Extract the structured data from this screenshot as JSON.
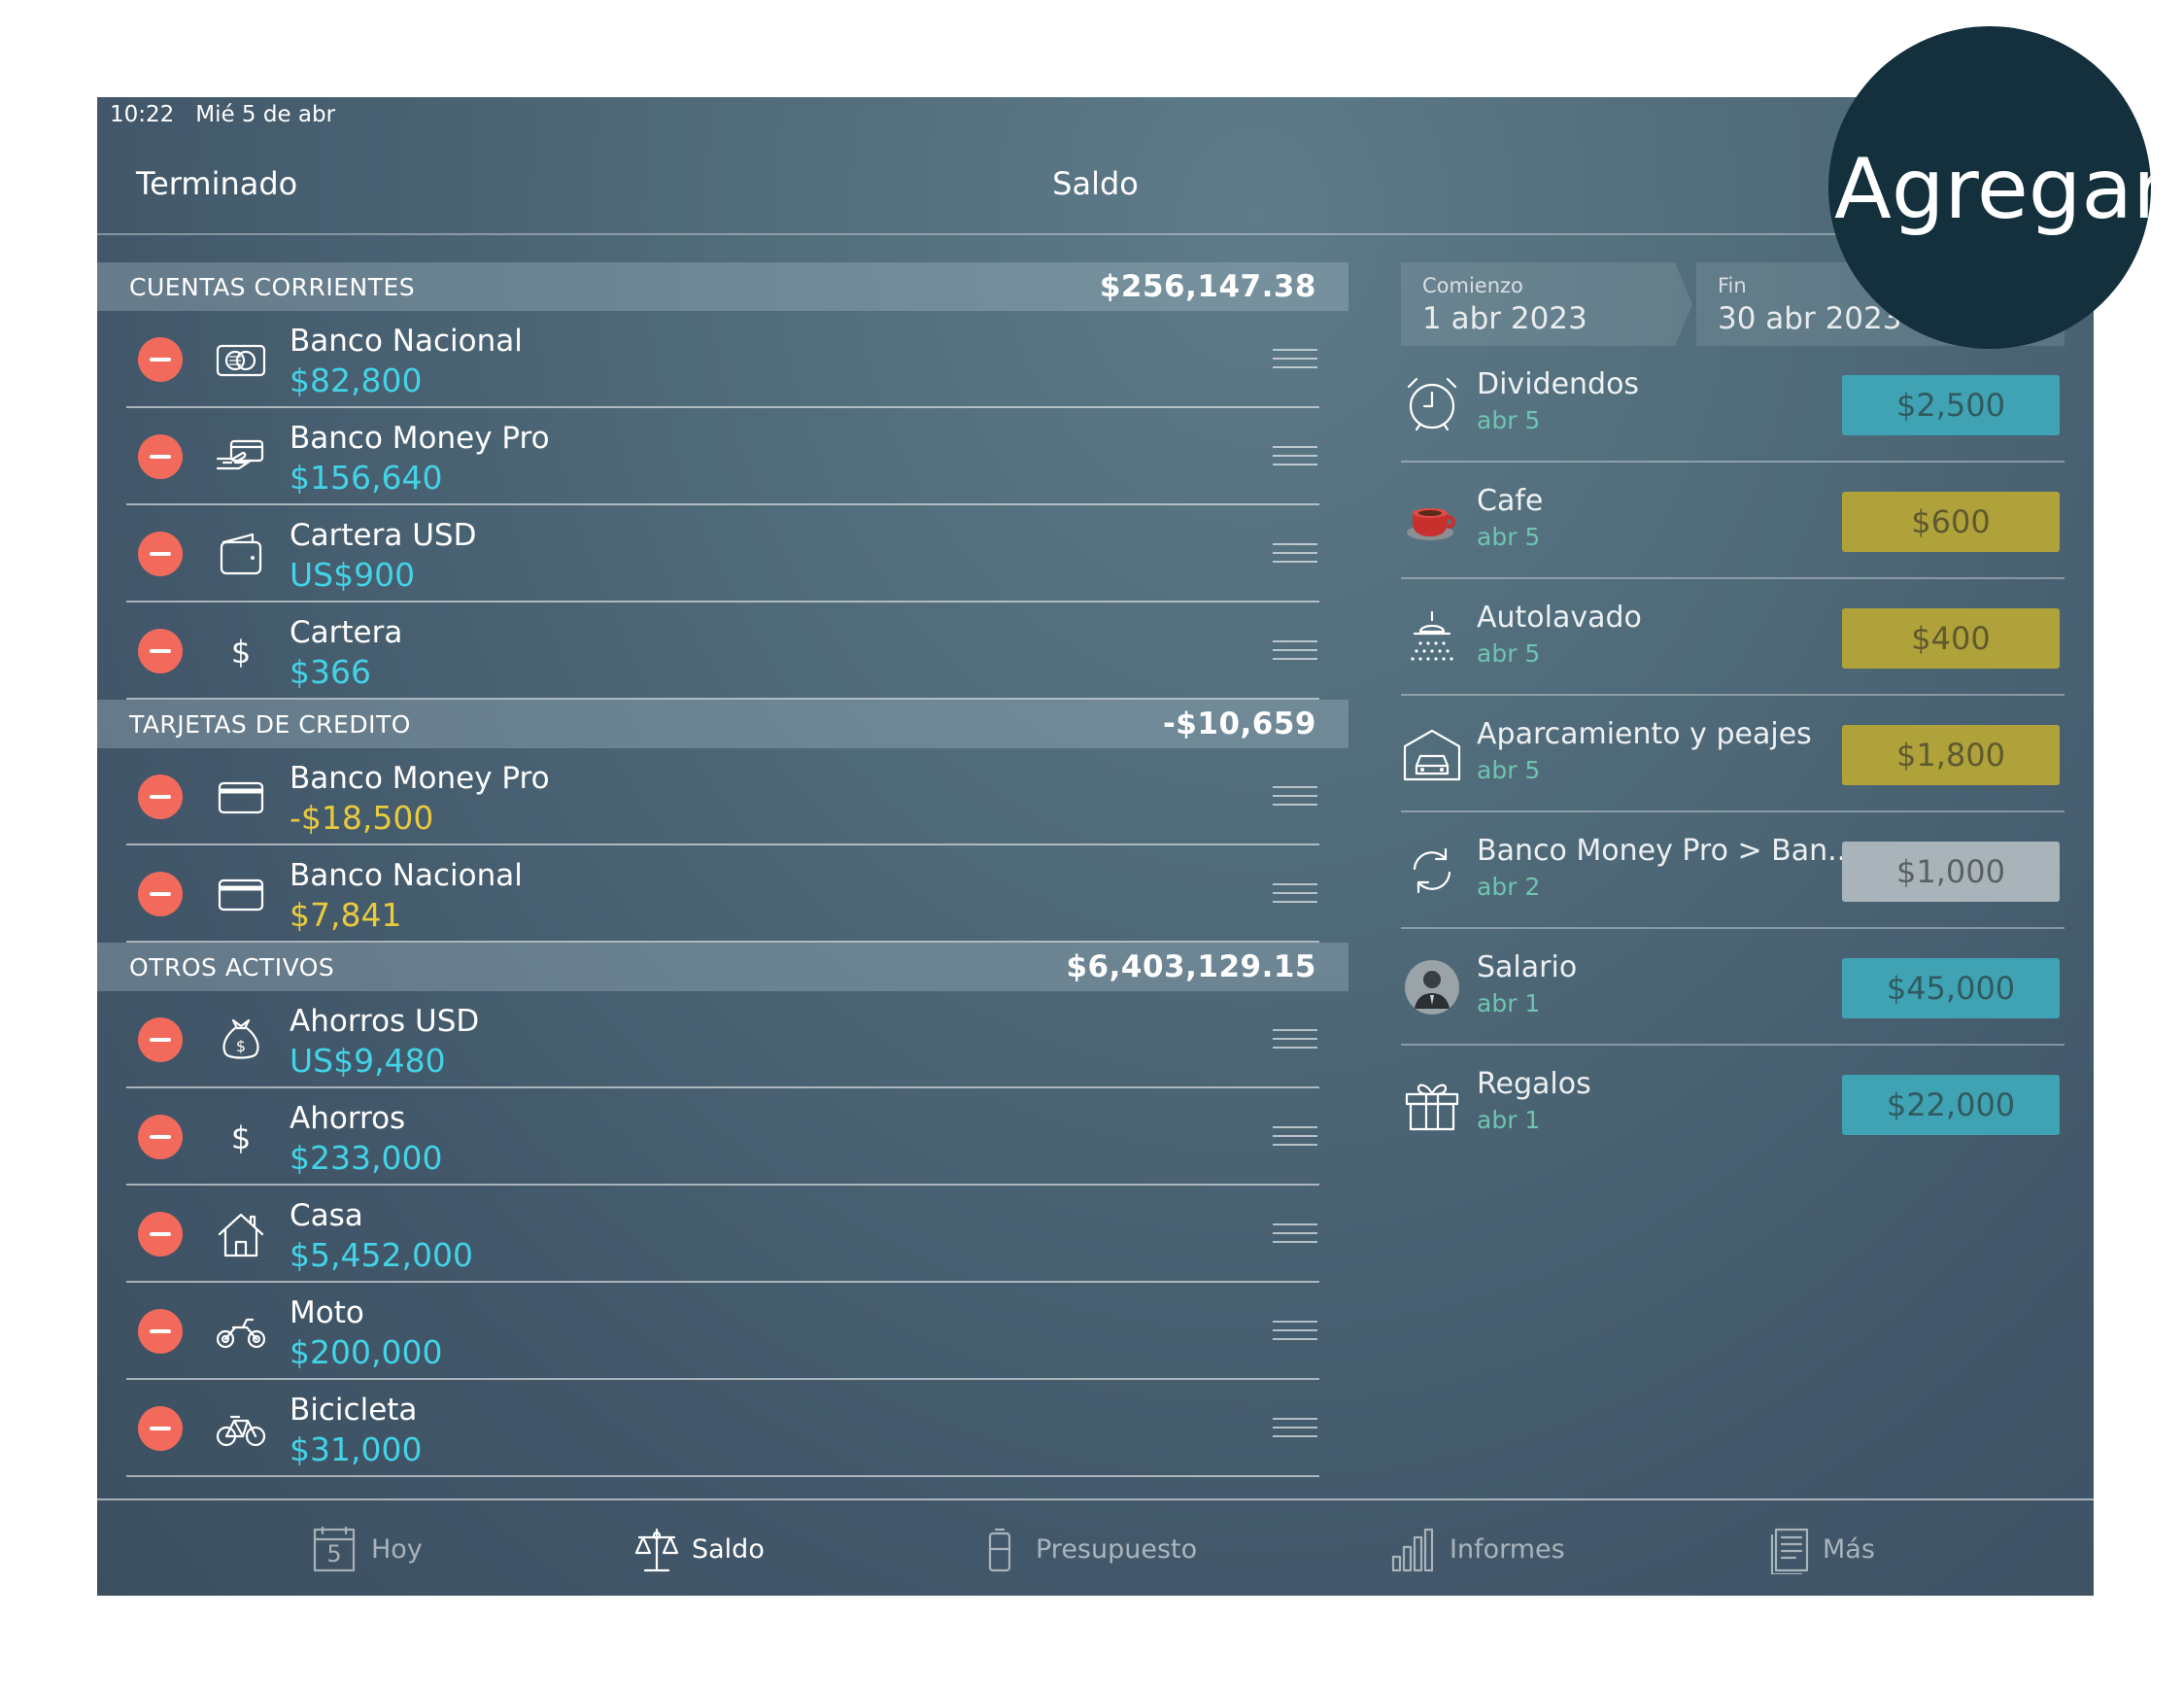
{
  "status_bar": {
    "time": "10:22",
    "date": "Mié 5 de abr"
  },
  "nav": {
    "done_label": "Terminado",
    "title": "Saldo",
    "add_label": "Agregar"
  },
  "sections": [
    {
      "name": "CUENTAS CORRIENTES",
      "total": "$256,147.38",
      "items": [
        {
          "name": "Banco Nacional",
          "amount": "$82,800",
          "icon": "bank-card-icon"
        },
        {
          "name": "Banco Money Pro",
          "amount": "$156,640",
          "icon": "hand-card-icon"
        },
        {
          "name": "Cartera USD",
          "amount": "US$900",
          "icon": "wallet-icon"
        },
        {
          "name": "Cartera",
          "amount": "$366",
          "icon": "dollar-icon"
        }
      ]
    },
    {
      "name": "TARJETAS DE CREDITO",
      "total": "-$10,659",
      "items": [
        {
          "name": "Banco Money Pro",
          "amount": "-$18,500",
          "icon": "credit-card-icon"
        },
        {
          "name": "Banco Nacional",
          "amount": "$7,841",
          "icon": "credit-card-icon"
        }
      ]
    },
    {
      "name": "OTROS ACTIVOS",
      "total": "$6,403,129.15",
      "items": [
        {
          "name": "Ahorros USD",
          "amount": "US$9,480",
          "icon": "money-bag-icon"
        },
        {
          "name": "Ahorros",
          "amount": "$233,000",
          "icon": "dollar-icon"
        },
        {
          "name": "Casa",
          "amount": "$5,452,000",
          "icon": "house-icon"
        },
        {
          "name": "Moto",
          "amount": "$200,000",
          "icon": "motorcycle-icon"
        },
        {
          "name": "Bicicleta",
          "amount": "$31,000",
          "icon": "bicycle-icon"
        }
      ]
    }
  ],
  "period": {
    "start_label": "Comienzo",
    "start_value": "1 abr 2023",
    "end_label": "Fin",
    "end_value": "30 abr 2023"
  },
  "transactions": [
    {
      "name": "Dividendos",
      "date": "abr 5",
      "amount": "$2,500",
      "color": "#3fa3b3",
      "icon": "alarm-clock-icon"
    },
    {
      "name": "Cafe",
      "date": "abr 5",
      "amount": "$600",
      "color": "#b0a23a",
      "icon": "coffee-cup-icon"
    },
    {
      "name": "Autolavado",
      "date": "abr 5",
      "amount": "$400",
      "color": "#b0a23a",
      "icon": "shower-icon"
    },
    {
      "name": "Aparcamiento y peajes",
      "date": "abr 5",
      "amount": "$1,800",
      "color": "#b0a23a",
      "icon": "garage-icon"
    },
    {
      "name": "Banco Money Pro > Ban...",
      "date": "abr 2",
      "amount": "$1,000",
      "color": "#a9b4ba",
      "icon": "transfer-icon"
    },
    {
      "name": "Salario",
      "date": "abr 1",
      "amount": "$45,000",
      "color": "#3fa3b3",
      "icon": "person-avatar-icon"
    },
    {
      "name": "Regalos",
      "date": "abr 1",
      "amount": "$22,000",
      "color": "#3fa3b3",
      "icon": "gift-icon"
    }
  ],
  "tabs": [
    {
      "label": "Hoy",
      "icon": "calendar-icon",
      "calendar_day": "5"
    },
    {
      "label": "Saldo",
      "icon": "scale-icon",
      "active": true
    },
    {
      "label": "Presupuesto",
      "icon": "battery-icon"
    },
    {
      "label": "Informes",
      "icon": "bar-chart-icon"
    },
    {
      "label": "Más",
      "icon": "document-icon"
    }
  ]
}
